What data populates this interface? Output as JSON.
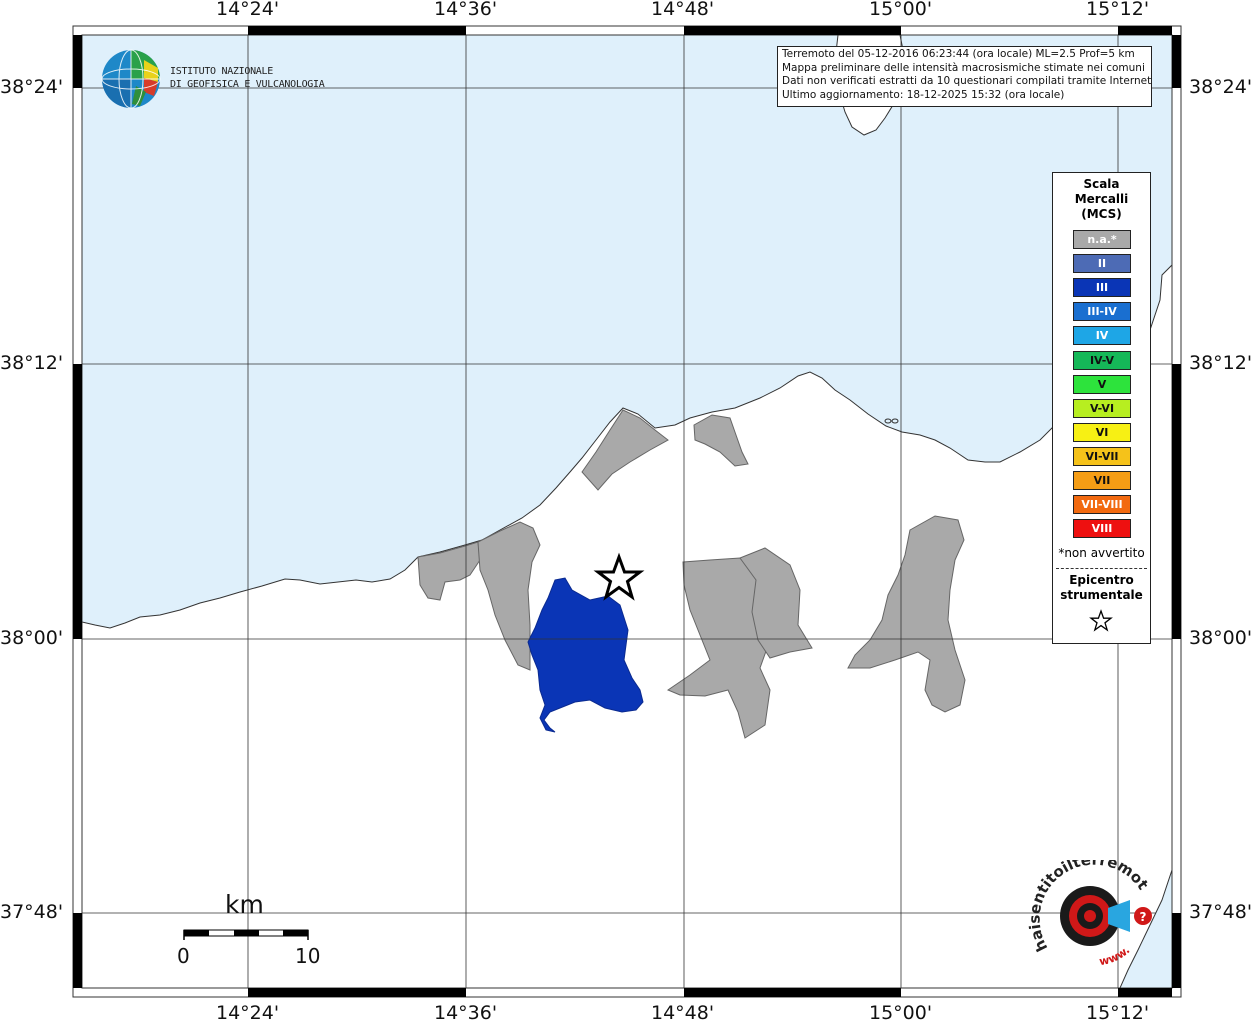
{
  "map": {
    "top_lon_labels": [
      "14°24'",
      "14°36'",
      "14°48'",
      "15°00'",
      "15°12'"
    ],
    "bottom_lon_labels": [
      "14°24'",
      "14°36'",
      "14°48'",
      "15°00'",
      "15°12'"
    ],
    "left_lat_labels": [
      "38°24'",
      "38°12'",
      "38°00'",
      "37°48'"
    ],
    "right_lat_labels": [
      "38°24'",
      "38°12'",
      "38°00'",
      "37°48'"
    ],
    "sea_color": "#dff0fb",
    "land_color": "#ffffff",
    "na_color": "#a9a9a9",
    "intensity_iii_color": "#0a35b6",
    "epicenter_icon": "star-icon"
  },
  "info": {
    "line1": "Terremoto del 05-12-2016 06:23:44 (ora locale) ML=2.5 Prof=5 km",
    "line2": "Mappa preliminare delle intensità macrosismiche stimate nei comuni",
    "line3": "Dati non verificati estratti da 10 questionari compilati tramite Internet.",
    "line4": "Ultimo aggiornamento: 18-12-2025 15:32 (ora locale)"
  },
  "logo_ingv": {
    "line1": "ISTITUTO NAZIONALE",
    "line2": "DI GEOFISICA E VULCANOLOGIA"
  },
  "legend": {
    "title1": "Scala",
    "title2": "Mercalli",
    "title3": "(MCS)",
    "items": [
      {
        "label": "n.a.*",
        "color": "#a9a9a9"
      },
      {
        "label": "II",
        "color": "#4d6bb5"
      },
      {
        "label": "III",
        "color": "#0a35b6"
      },
      {
        "label": "III-IV",
        "color": "#1a6fd0"
      },
      {
        "label": "IV",
        "color": "#1ea6e6"
      },
      {
        "label": "IV-V",
        "color": "#15b858"
      },
      {
        "label": "V",
        "color": "#2de33c"
      },
      {
        "label": "V-VI",
        "color": "#b7ee20"
      },
      {
        "label": "VI",
        "color": "#f7f014"
      },
      {
        "label": "VI-VII",
        "color": "#f5c21a"
      },
      {
        "label": "VII",
        "color": "#f59d15"
      },
      {
        "label": "VII-VIII",
        "color": "#f26a10"
      },
      {
        "label": "VIII",
        "color": "#ee1010"
      }
    ],
    "note": "*non avvertito",
    "epi1": "Epicentro",
    "epi2": "strumentale"
  },
  "scalebar": {
    "unit": "km",
    "label_start": "0",
    "label_end": "10"
  },
  "hst_logo": {
    "text_top": "haisentitoilterremoto.it",
    "text_bottom": "www."
  }
}
